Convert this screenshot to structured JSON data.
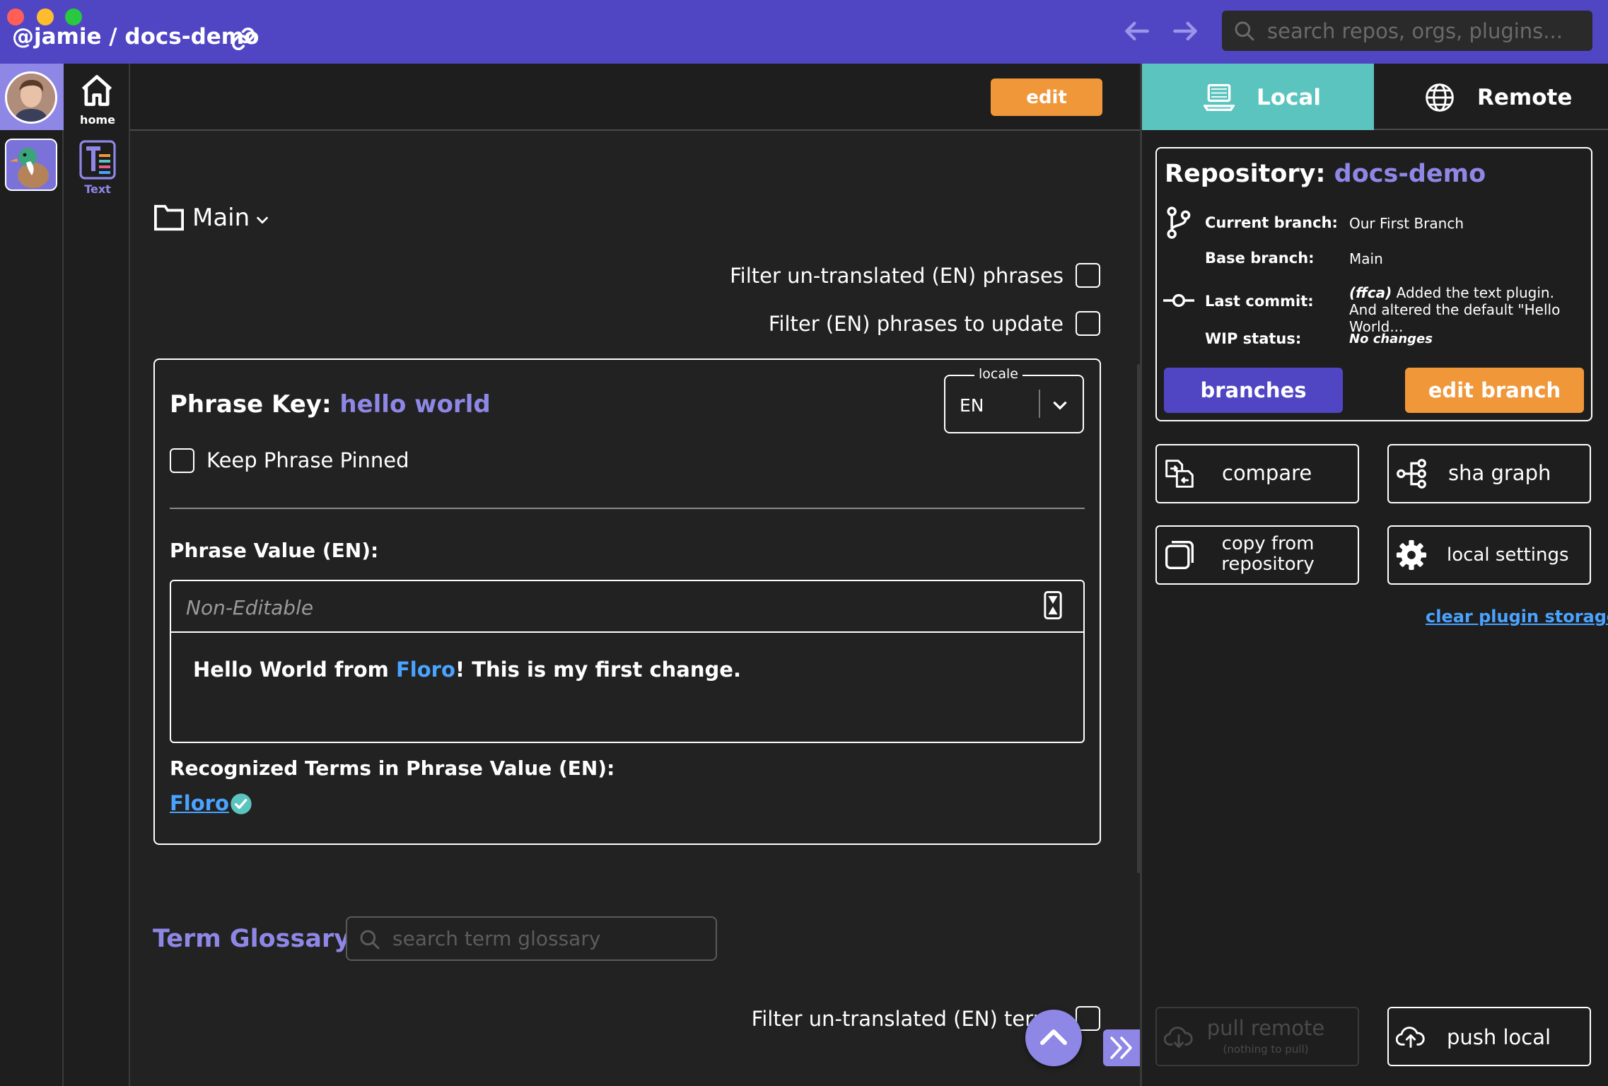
{
  "window": {
    "repo_path": "@jamie / docs-demo"
  },
  "top_search": {
    "placeholder": "search repos, orgs, plugins..."
  },
  "nav": {
    "home_label": "home",
    "text_label": "Text"
  },
  "toolbar": {
    "edit_label": "edit"
  },
  "folder": {
    "name": "Main"
  },
  "filters": {
    "untranslated_phrases": "Filter un-translated (EN) phrases",
    "phrases_to_update": "Filter (EN) phrases to update",
    "untranslated_terms": "Filter un-translated (EN) terms"
  },
  "phrase": {
    "key_label": "Phrase Key",
    "key_value": "hello world",
    "locale_legend": "locale",
    "locale_value": "EN",
    "pin_label": "Keep Phrase Pinned",
    "value_label": "Phrase Value (EN):",
    "non_editable": "Non-Editable",
    "value_before": "Hello World from ",
    "value_term": "Floro",
    "value_after": "! This is my first change.",
    "terms_label": "Recognized Terms in Phrase Value (EN):",
    "term_link": "Floro"
  },
  "glossary": {
    "title": "Term Glossary",
    "search_placeholder": "search term glossary"
  },
  "right_panel": {
    "tab_local": "Local",
    "tab_remote": "Remote",
    "repo_label": "Repository",
    "repo_name": "docs-demo",
    "current_branch_label": "Current branch:",
    "current_branch_value": "Our First Branch",
    "base_branch_label": "Base branch:",
    "base_branch_value": "Main",
    "last_commit_label": "Last commit:",
    "last_commit_sha": "(ffca)",
    "last_commit_message": "Added the text plugin. And altered the default \"Hello World...",
    "wip_label": "WIP status:",
    "wip_value": "No changes",
    "branches_label": "branches",
    "edit_branch_label": "edit branch",
    "compare_label": "compare",
    "sha_graph_label": "sha graph",
    "copy_from_repo_label": "copy from repository",
    "local_settings_label": "local settings",
    "clear_storage_label": "clear plugin storage",
    "pull_label": "pull remote",
    "pull_sub": "(nothing to pull)",
    "push_label": "push local"
  },
  "colors": {
    "brand_purple": "#5046c4",
    "accent_lavender": "#8f87e6",
    "accent_orange": "#f0973a",
    "accent_teal": "#5bc4be",
    "link_blue": "#4aa3ff",
    "background": "#222222"
  }
}
